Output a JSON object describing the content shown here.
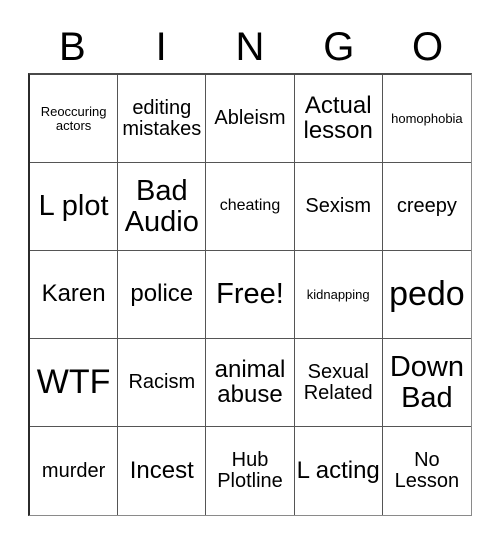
{
  "card": {
    "header": {
      "letters": [
        "B",
        "I",
        "N",
        "G",
        "O"
      ]
    },
    "grid": {
      "columns": 5,
      "rows": 5,
      "free_space_label": "Free!",
      "cells": [
        {
          "text": "Reoccuring actors",
          "size": "s-xs"
        },
        {
          "text": "editing mistakes",
          "size": "s-md"
        },
        {
          "text": "Ableism",
          "size": "s-md"
        },
        {
          "text": "Actual lesson",
          "size": "s-lg"
        },
        {
          "text": "homophobia",
          "size": "s-xs"
        },
        {
          "text": "L plot",
          "size": "s-xl"
        },
        {
          "text": "Bad Audio",
          "size": "s-xl"
        },
        {
          "text": "cheating",
          "size": "s-sm"
        },
        {
          "text": "Sexism",
          "size": "s-md"
        },
        {
          "text": "creepy",
          "size": "s-md"
        },
        {
          "text": "Karen",
          "size": "s-lg"
        },
        {
          "text": "police",
          "size": "s-lg"
        },
        {
          "text": "Free!",
          "size": "s-xl"
        },
        {
          "text": "kidnapping",
          "size": "s-xs"
        },
        {
          "text": "pedo",
          "size": "s-xxl"
        },
        {
          "text": "WTF",
          "size": "s-xxl"
        },
        {
          "text": "Racism",
          "size": "s-md"
        },
        {
          "text": "animal abuse",
          "size": "s-lg"
        },
        {
          "text": "Sexual Related",
          "size": "s-md"
        },
        {
          "text": "Down Bad",
          "size": "s-xl"
        },
        {
          "text": "murder",
          "size": "s-md"
        },
        {
          "text": "Incest",
          "size": "s-lg"
        },
        {
          "text": "Hub Plotline",
          "size": "s-md"
        },
        {
          "text": "L acting",
          "size": "s-lg"
        },
        {
          "text": "No Lesson",
          "size": "s-md"
        }
      ]
    },
    "colors": {
      "background": "#ffffff",
      "text": "#000000",
      "grid_line": "#555555",
      "outer_border": "#2b2b2b"
    }
  }
}
